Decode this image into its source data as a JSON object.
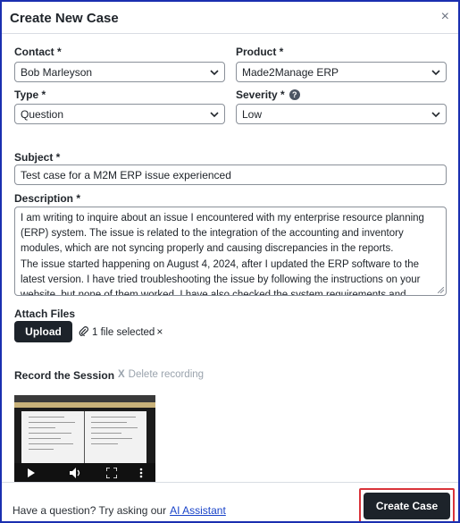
{
  "dialog": {
    "title": "Create New Case",
    "close_glyph": "×"
  },
  "form": {
    "contact": {
      "label": "Contact *",
      "value": "Bob Marleyson"
    },
    "product": {
      "label": "Product *",
      "value": "Made2Manage ERP"
    },
    "type": {
      "label": "Type *",
      "value": "Question"
    },
    "severity": {
      "label": "Severity *",
      "value": "Low",
      "help_glyph": "?"
    },
    "subject": {
      "label": "Subject *",
      "value": "Test case for a M2M ERP issue experienced"
    },
    "description": {
      "label": "Description *",
      "paragraphs": [
        "I am writing to inquire about an issue I encountered with my enterprise resource planning (ERP) system. The issue is related to the integration of the accounting and inventory modules, which are not syncing properly and causing discrepancies in the reports.",
        "The issue started happening on August 4, 2024, after I updated the ERP software to the latest version. I have tried troubleshooting the issue by following the instructions on your website, but none of them worked. I have also checked the system requirements and confirmed that my"
      ]
    }
  },
  "attach": {
    "label": "Attach Files",
    "upload_label": "Upload",
    "file_status": "1 file selected",
    "remove_glyph": "×"
  },
  "recording": {
    "label": "Record the Session",
    "delete_label": "Delete recording",
    "delete_glyph": "X"
  },
  "footer": {
    "question": "Have a question? Try asking our",
    "ai_link": "AI Assistant",
    "create_label": "Create Case"
  },
  "colors": {
    "primary_dark": "#1d232a",
    "link": "#1a44c9",
    "highlight": "#d9343a",
    "frame": "#1a2fb0"
  }
}
